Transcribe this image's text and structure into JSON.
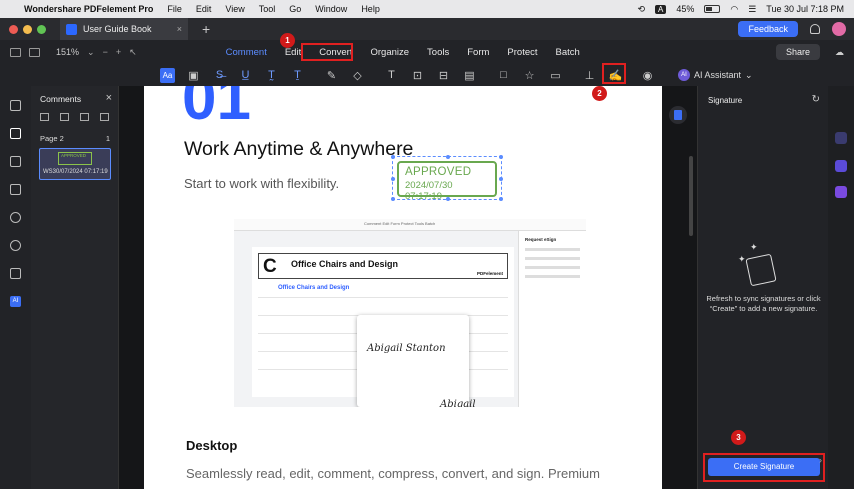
{
  "menubar": {
    "app_name": "Wondershare PDFelement Pro",
    "items": [
      "File",
      "Edit",
      "View",
      "Tool",
      "Go",
      "Window",
      "Help"
    ],
    "input_indicator": "A",
    "battery": "45%",
    "datetime": "Tue 30 Jul 7:18 PM"
  },
  "titlebar": {
    "doc_tab": "User Guide Book",
    "new_tab": "+",
    "feedback": "Feedback"
  },
  "toolbar": {
    "zoom": "151%",
    "tabs": [
      "Comment",
      "Edit",
      "Convert",
      "Organize",
      "Tools",
      "Form",
      "Protect",
      "Batch"
    ],
    "active_tab": "Comment",
    "share": "Share",
    "ai_assistant": "AI Assistant"
  },
  "comments_panel": {
    "title": "Comments",
    "page_label": "Page 2",
    "page_count": "1",
    "thumb_stamp_line1": "APPROVED",
    "thumb_meta": "WS30/07/2024 07:17:19"
  },
  "document": {
    "big_number": "01",
    "heading": "Work Anytime & Anywhere",
    "subheading": "Start to work with flexibility.",
    "stamp_text": "APPROVED",
    "stamp_date": "2024/07/30 07:17:19",
    "inner_screenshot": {
      "topbar": "Comment  Edit  Form  Protect  Tools  Batch",
      "title": "Office Chairs and Design",
      "brand": "PDFelement",
      "table_title": "Office Chairs and Design",
      "signature": "Abigail Stanton",
      "side_title": "Request eSign"
    },
    "section_title": "Desktop",
    "section_text": "Seamlessly read, edit, comment, compress, convert, and sign. Premium"
  },
  "signature_panel": {
    "title": "Signature",
    "message": "Refresh to sync signatures or click “Create” to add a new signature.",
    "create_button": "Create Signature"
  },
  "annotations": {
    "badge1": "1",
    "badge2": "2",
    "badge3": "3",
    "color": "#e02020"
  }
}
